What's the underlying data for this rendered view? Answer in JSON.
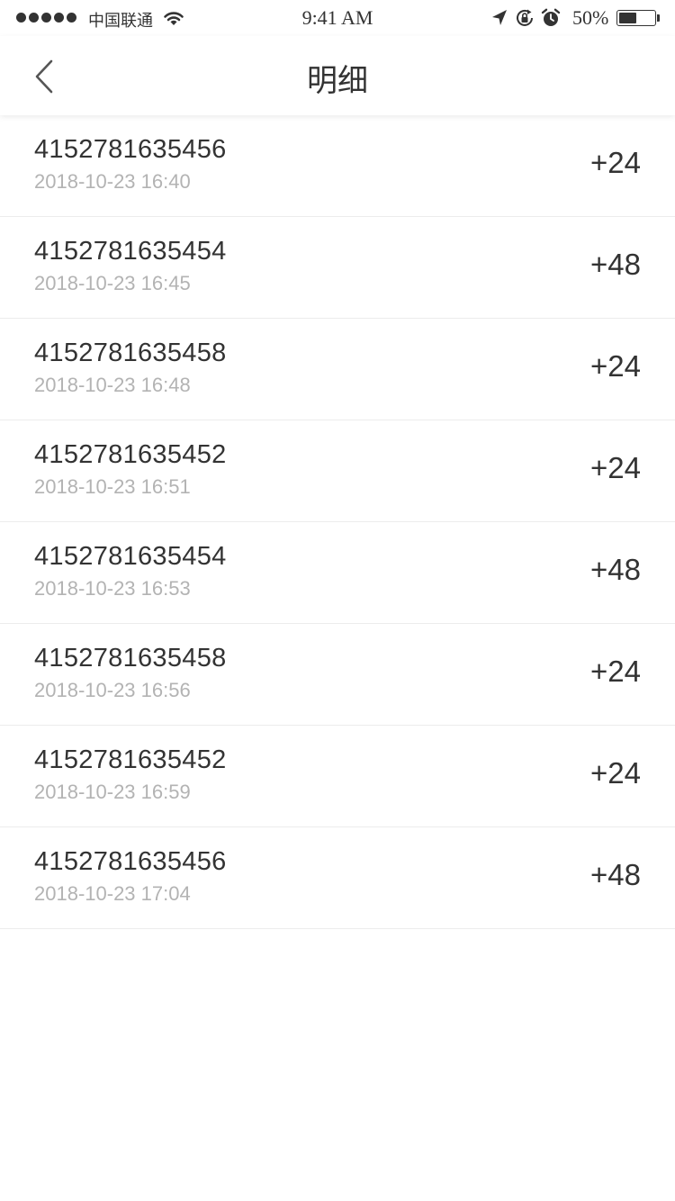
{
  "status_bar": {
    "carrier": "中国联通",
    "time": "9:41 AM",
    "battery_text": "50%",
    "battery_level": 0.5,
    "icons": [
      "signal-dots",
      "wifi-icon",
      "location-icon",
      "lock-rotation-icon",
      "alarm-icon",
      "battery-icon"
    ]
  },
  "nav": {
    "title": "明细",
    "back_icon": "chevron-left-icon"
  },
  "items": [
    {
      "number": "4152781635456",
      "time": "2018-10-23 16:40",
      "amount": "+24"
    },
    {
      "number": "4152781635454",
      "time": "2018-10-23 16:45",
      "amount": "+48"
    },
    {
      "number": "4152781635458",
      "time": "2018-10-23 16:48",
      "amount": "+24"
    },
    {
      "number": "4152781635452",
      "time": "2018-10-23 16:51",
      "amount": "+24"
    },
    {
      "number": "4152781635454",
      "time": "2018-10-23 16:53",
      "amount": "+48"
    },
    {
      "number": "4152781635458",
      "time": "2018-10-23 16:56",
      "amount": "+24"
    },
    {
      "number": "4152781635452",
      "time": "2018-10-23 16:59",
      "amount": "+24"
    },
    {
      "number": "4152781635456",
      "time": "2018-10-23 17:04",
      "amount": "+48"
    }
  ],
  "colors": {
    "text_primary": "#333333",
    "text_secondary": "#b3b3b3",
    "divider": "#ececec",
    "background": "#ffffff"
  }
}
